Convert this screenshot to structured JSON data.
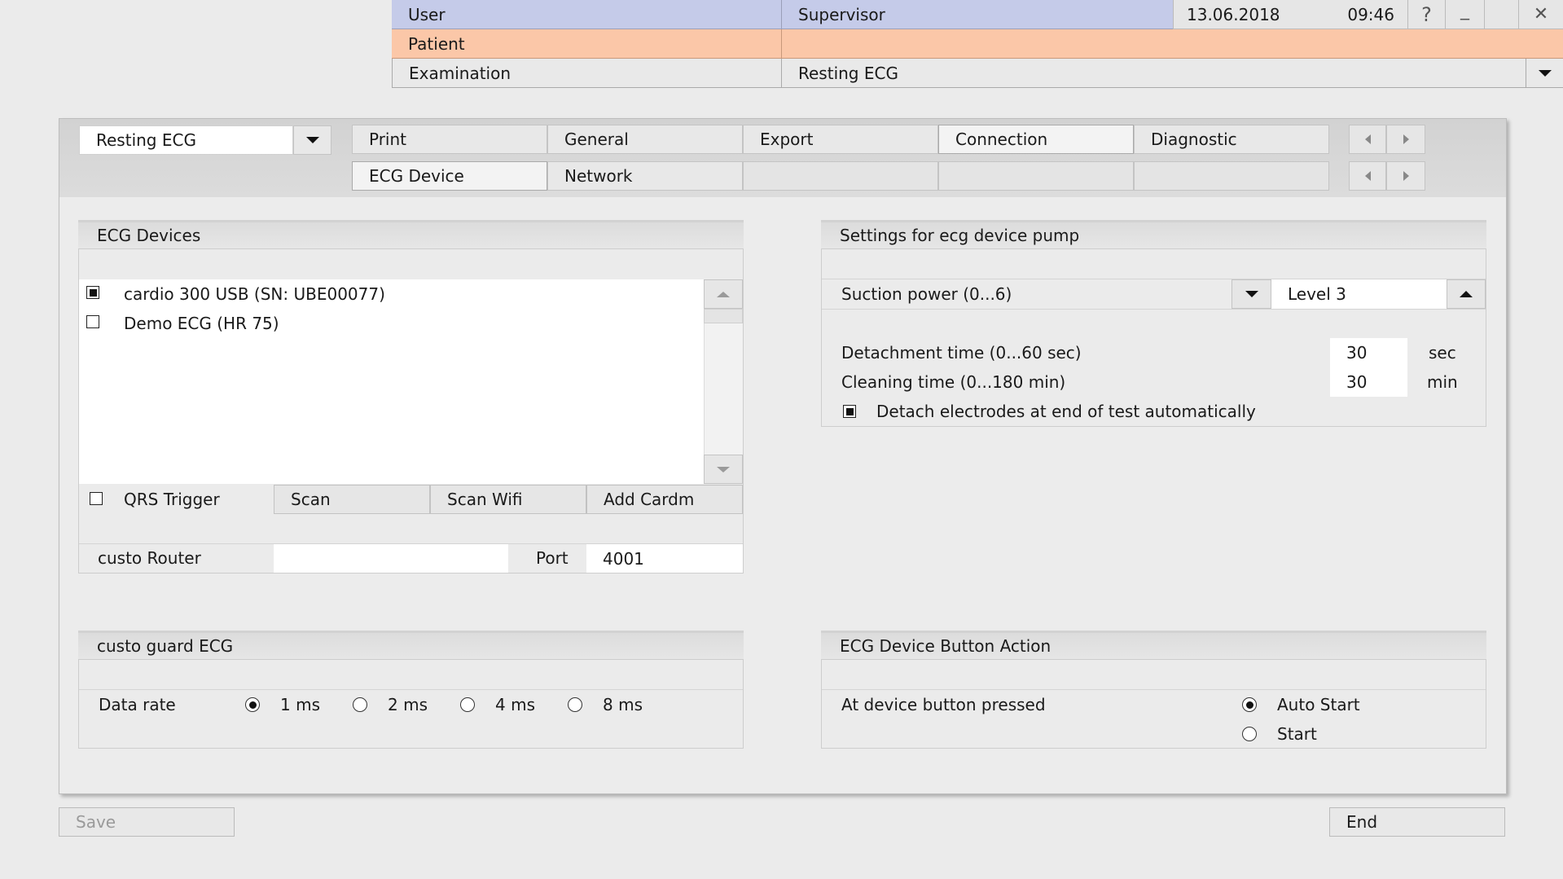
{
  "header": {
    "user_label": "User",
    "user_value": "Supervisor",
    "date": "13.06.2018",
    "time": "09:46",
    "help_icon": "?",
    "minimize_icon": "_",
    "close_icon": "✕",
    "patient_label": "Patient",
    "patient_value": "",
    "exam_label": "Examination",
    "exam_value": "Resting ECG"
  },
  "toolbar": {
    "module_select": "Resting ECG",
    "tabs_row1": [
      "Print",
      "General",
      "Export",
      "Connection",
      "Diagnostic"
    ],
    "tabs_row2": [
      "ECG Device",
      "Network",
      "",
      "",
      ""
    ],
    "active_row1": "Connection",
    "active_row2": "ECG Device"
  },
  "ecg_devices": {
    "title": "ECG Devices",
    "items": [
      {
        "label": "cardio 300 USB (SN: UBE00077)",
        "checked": true
      },
      {
        "label": "Demo ECG (HR 75)",
        "checked": false
      }
    ],
    "qrs_trigger_label": "QRS Trigger",
    "qrs_trigger_checked": false,
    "scan_label": "Scan",
    "scan_wifi_label": "Scan Wifi",
    "add_cardm_label": "Add Cardm",
    "router_label": "custo Router",
    "router_value": "",
    "port_label": "Port",
    "port_value": "4001"
  },
  "pump": {
    "title": "Settings for ecg device pump",
    "suction_label": "Suction power (0...6)",
    "suction_value": "Level 3",
    "detachment_label": "Detachment time (0...60 sec)",
    "detachment_value": "30",
    "detachment_unit": "sec",
    "cleaning_label": "Cleaning time (0...180 min)",
    "cleaning_value": "30",
    "cleaning_unit": "min",
    "detach_auto_label": "Detach electrodes at end of test automatically",
    "detach_auto_checked": true
  },
  "guard": {
    "title": "custo guard ECG",
    "data_rate_label": "Data rate",
    "options": [
      "1 ms",
      "2 ms",
      "4 ms",
      "8 ms"
    ],
    "selected": "1 ms"
  },
  "button_action": {
    "title": "ECG Device Button Action",
    "pressed_label": "At device button pressed",
    "options": [
      "Auto Start",
      "Start"
    ],
    "selected": "Auto Start"
  },
  "footer": {
    "save_label": "Save",
    "end_label": "End"
  },
  "colors": {
    "user_bar": "#c5cbe9",
    "patient_bar": "#fbc7a8",
    "background": "#ebebeb"
  }
}
